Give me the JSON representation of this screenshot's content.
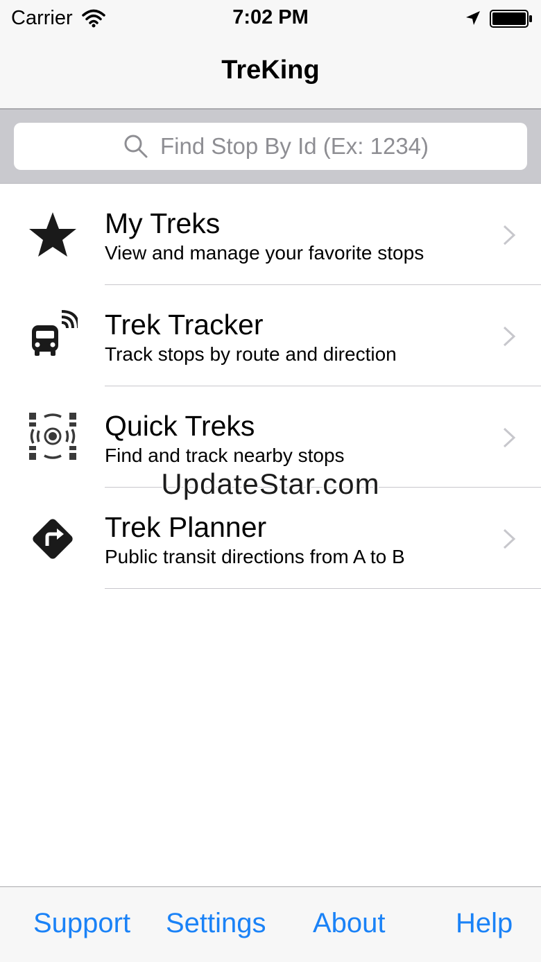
{
  "status_bar": {
    "carrier": "Carrier",
    "time": "7:02 PM",
    "icons": [
      "wifi-icon",
      "location-arrow-icon",
      "battery-icon"
    ]
  },
  "nav": {
    "title": "TreKing"
  },
  "search": {
    "placeholder": "Find Stop By Id (Ex: 1234)",
    "icon": "search-icon"
  },
  "menu": [
    {
      "title": "My Treks",
      "subtitle": "View and manage your favorite stops",
      "icon": "star-icon"
    },
    {
      "title": "Trek Tracker",
      "subtitle": "Track stops by route and direction",
      "icon": "bus-tracking-icon"
    },
    {
      "title": "Quick Treks",
      "subtitle": "Find and track nearby stops",
      "icon": "nearby-stops-icon"
    },
    {
      "title": "Trek Planner",
      "subtitle": "Public transit directions from A to B",
      "icon": "directions-icon"
    }
  ],
  "watermark": "UpdateStar.com",
  "tabs": [
    "Support",
    "Settings",
    "About",
    "Help"
  ],
  "colors": {
    "accent": "#1a82f7",
    "bar_background": "#f7f7f7",
    "search_background": "#c9c9ce"
  }
}
